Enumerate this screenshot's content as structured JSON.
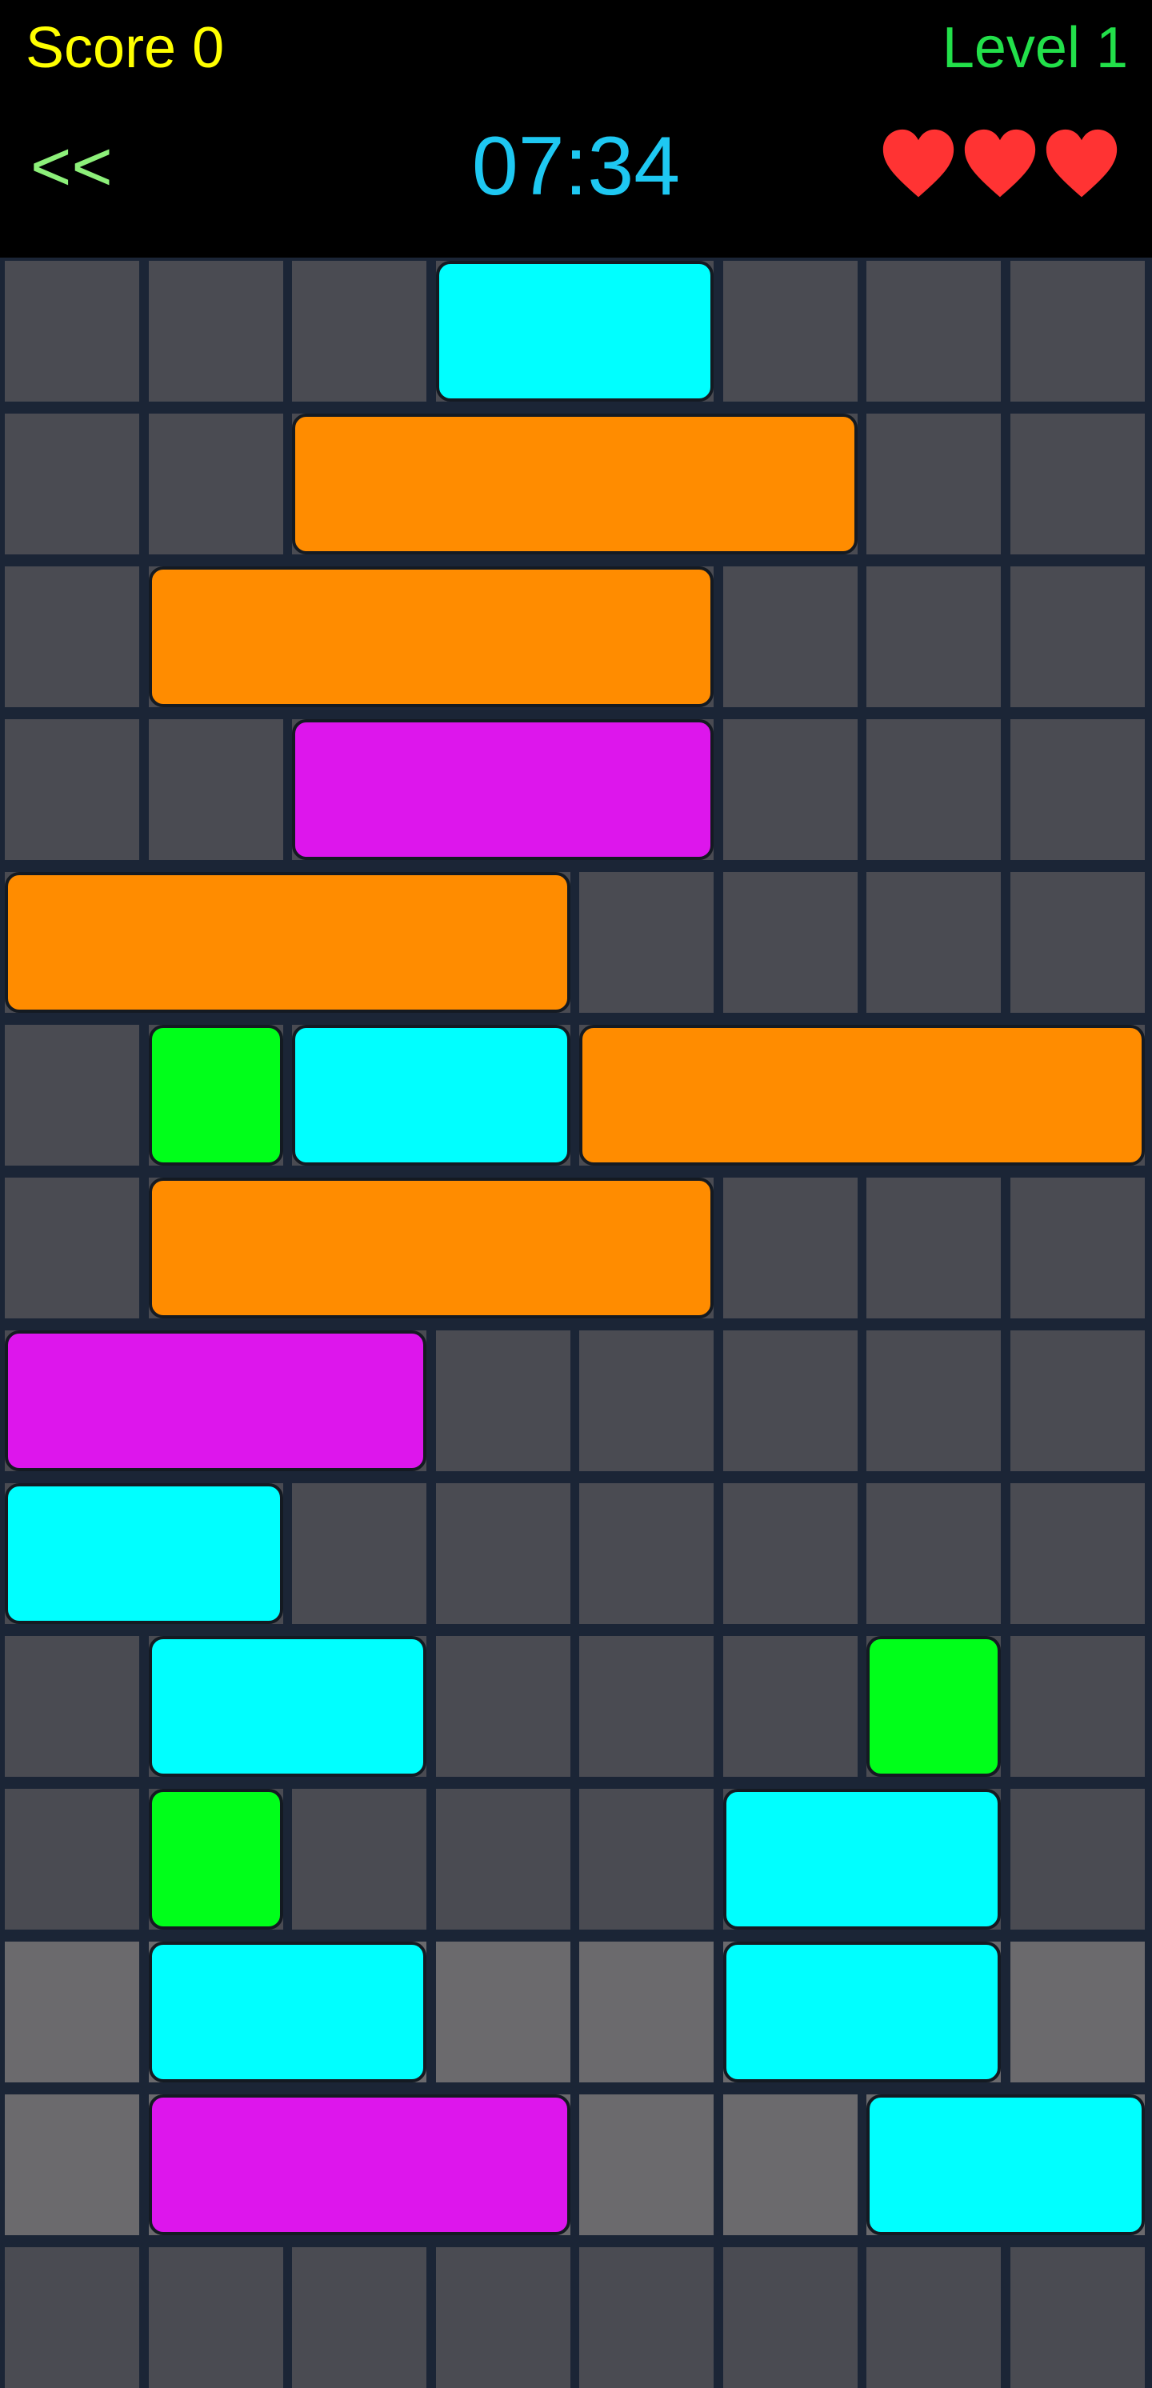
{
  "header": {
    "score_label": "Score 0",
    "level_label": "Level 1",
    "back_label": "<<",
    "timer": "07:34",
    "lives": 3,
    "heart_icon": "heart-icon"
  },
  "colors": {
    "header_bg": "#000000",
    "score": "#ffff00",
    "level": "#22e04a",
    "back": "#8df07a",
    "timer": "#1ec8f2",
    "heart": "#ff3333",
    "cell": "#4a4b52",
    "cell_light": "#6b6a6d",
    "grid_line": "#1b2536"
  },
  "board": {
    "columns": 8,
    "rows": 14,
    "light_rows": [
      11,
      12
    ],
    "blocks": [
      {
        "row": 0,
        "col": 3,
        "len": 2,
        "color": "cyan"
      },
      {
        "row": 1,
        "col": 2,
        "len": 4,
        "color": "orange"
      },
      {
        "row": 2,
        "col": 1,
        "len": 4,
        "color": "orange"
      },
      {
        "row": 3,
        "col": 2,
        "len": 3,
        "color": "magenta"
      },
      {
        "row": 4,
        "col": 0,
        "len": 4,
        "color": "orange"
      },
      {
        "row": 5,
        "col": 1,
        "len": 1,
        "color": "green"
      },
      {
        "row": 5,
        "col": 2,
        "len": 2,
        "color": "cyan"
      },
      {
        "row": 5,
        "col": 4,
        "len": 4,
        "color": "orange"
      },
      {
        "row": 6,
        "col": 1,
        "len": 4,
        "color": "orange"
      },
      {
        "row": 7,
        "col": 0,
        "len": 3,
        "color": "magenta"
      },
      {
        "row": 8,
        "col": 0,
        "len": 2,
        "color": "cyan"
      },
      {
        "row": 9,
        "col": 1,
        "len": 2,
        "color": "cyan"
      },
      {
        "row": 9,
        "col": 6,
        "len": 1,
        "color": "green"
      },
      {
        "row": 10,
        "col": 1,
        "len": 1,
        "color": "green"
      },
      {
        "row": 10,
        "col": 5,
        "len": 2,
        "color": "cyan"
      },
      {
        "row": 11,
        "col": 1,
        "len": 2,
        "color": "cyan"
      },
      {
        "row": 11,
        "col": 5,
        "len": 2,
        "color": "cyan"
      },
      {
        "row": 12,
        "col": 1,
        "len": 3,
        "color": "magenta"
      },
      {
        "row": 12,
        "col": 6,
        "len": 2,
        "color": "cyan"
      }
    ],
    "block_colors": {
      "cyan": "#00ffff",
      "orange": "#ff8c00",
      "magenta": "#dd16ec",
      "green": "#00ff1a"
    }
  }
}
